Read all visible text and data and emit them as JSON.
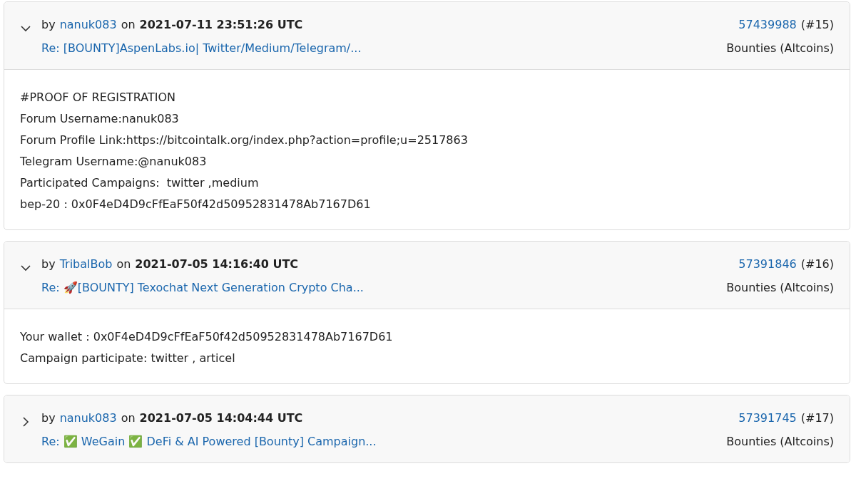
{
  "posts": [
    {
      "expanded": true,
      "by": "by",
      "author": "nanuk083",
      "on": "on",
      "date": "2021-07-11 23:51:26 UTC",
      "topic": "Re: [BOUNTY]AspenLabs.io| Twitter/Medium/Telegram/...",
      "post_id": "57439988",
      "number": "(#15)",
      "board": "Bounties (Altcoins)",
      "body": [
        "#PROOF OF REGISTRATION",
        "Forum Username:nanuk083",
        "Forum Profile Link:https://bitcointalk.org/index.php?action=profile;u=2517863",
        "Telegram Username:@nanuk083",
        "Participated Campaigns:  twitter ,medium",
        "bep-20 : 0x0F4eD4D9cFfEaF50f42d50952831478Ab7167D61"
      ]
    },
    {
      "expanded": true,
      "by": "by",
      "author": "TribalBob",
      "on": "on",
      "date": "2021-07-05 14:16:40 UTC",
      "topic": "Re: 🚀[BOUNTY] Texochat Next Generation Crypto Cha...",
      "post_id": "57391846",
      "number": "(#16)",
      "board": "Bounties (Altcoins)",
      "body": [
        "Your wallet : 0x0F4eD4D9cFfEaF50f42d50952831478Ab7167D61",
        "Campaign participate: twitter , articel"
      ]
    },
    {
      "expanded": false,
      "by": "by",
      "author": "nanuk083",
      "on": "on",
      "date": "2021-07-05 14:04:44 UTC",
      "topic": "Re: ✅ WeGain ✅ DeFi & AI Powered [Bounty] Campaign...",
      "post_id": "57391745",
      "number": "(#17)",
      "board": "Bounties (Altcoins)"
    }
  ]
}
